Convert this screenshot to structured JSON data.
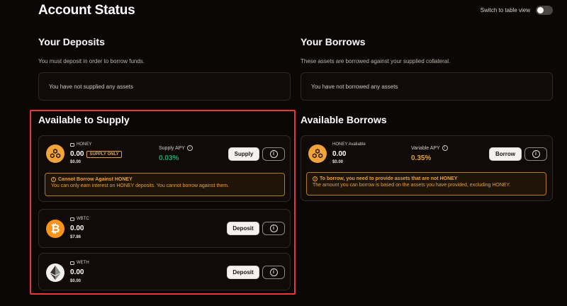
{
  "page_title": "Account Status",
  "toggle": {
    "label": "Switch to table view",
    "on": false
  },
  "deposits": {
    "title": "Your Deposits",
    "description": "You must deposit in order to borrow funds.",
    "empty": "You have not supplied any assets"
  },
  "borrows": {
    "title": "Your Borrows",
    "description": "These assets are borrowed against your supplied collateral.",
    "empty": "You have not borrowed any assets"
  },
  "supply": {
    "title": "Available to Supply",
    "items": [
      {
        "symbol": "HONEY",
        "amount": "0.00",
        "usd": "$0.00",
        "badge": "SUPPLY ONLY",
        "apy_label": "Supply APY",
        "apy_value": "0.03%",
        "action": "Supply",
        "icon": "honey-icon",
        "warning": {
          "title": "Cannot Borrow Against HONEY",
          "body": "You can only earn interest on HONEY deposits. You cannot borrow against them."
        }
      },
      {
        "symbol": "WBTC",
        "amount": "0.00",
        "usd": "$7.86",
        "action": "Deposit",
        "icon": "bitcoin-icon"
      },
      {
        "symbol": "WETH",
        "amount": "0.00",
        "usd": "$0.00",
        "action": "Deposit",
        "icon": "ethereum-icon"
      }
    ]
  },
  "available_borrows": {
    "title": "Available Borrows",
    "item": {
      "label": "HONEY Avaliable",
      "amount": "0.00",
      "usd": "$0.00",
      "apy_label": "Variable APY",
      "apy_value": "0.35%",
      "action": "Borrow",
      "icon": "honey-icon"
    },
    "warning": {
      "title": "To borrow, you need to provide assets that are not HONEY",
      "body": "The amount you can borrow is based on the assets you have provided, excluding HONEY."
    }
  },
  "colors": {
    "accent_green": "#19a86b",
    "accent_orange": "#e8a23a",
    "highlight_red": "#e8343a"
  }
}
